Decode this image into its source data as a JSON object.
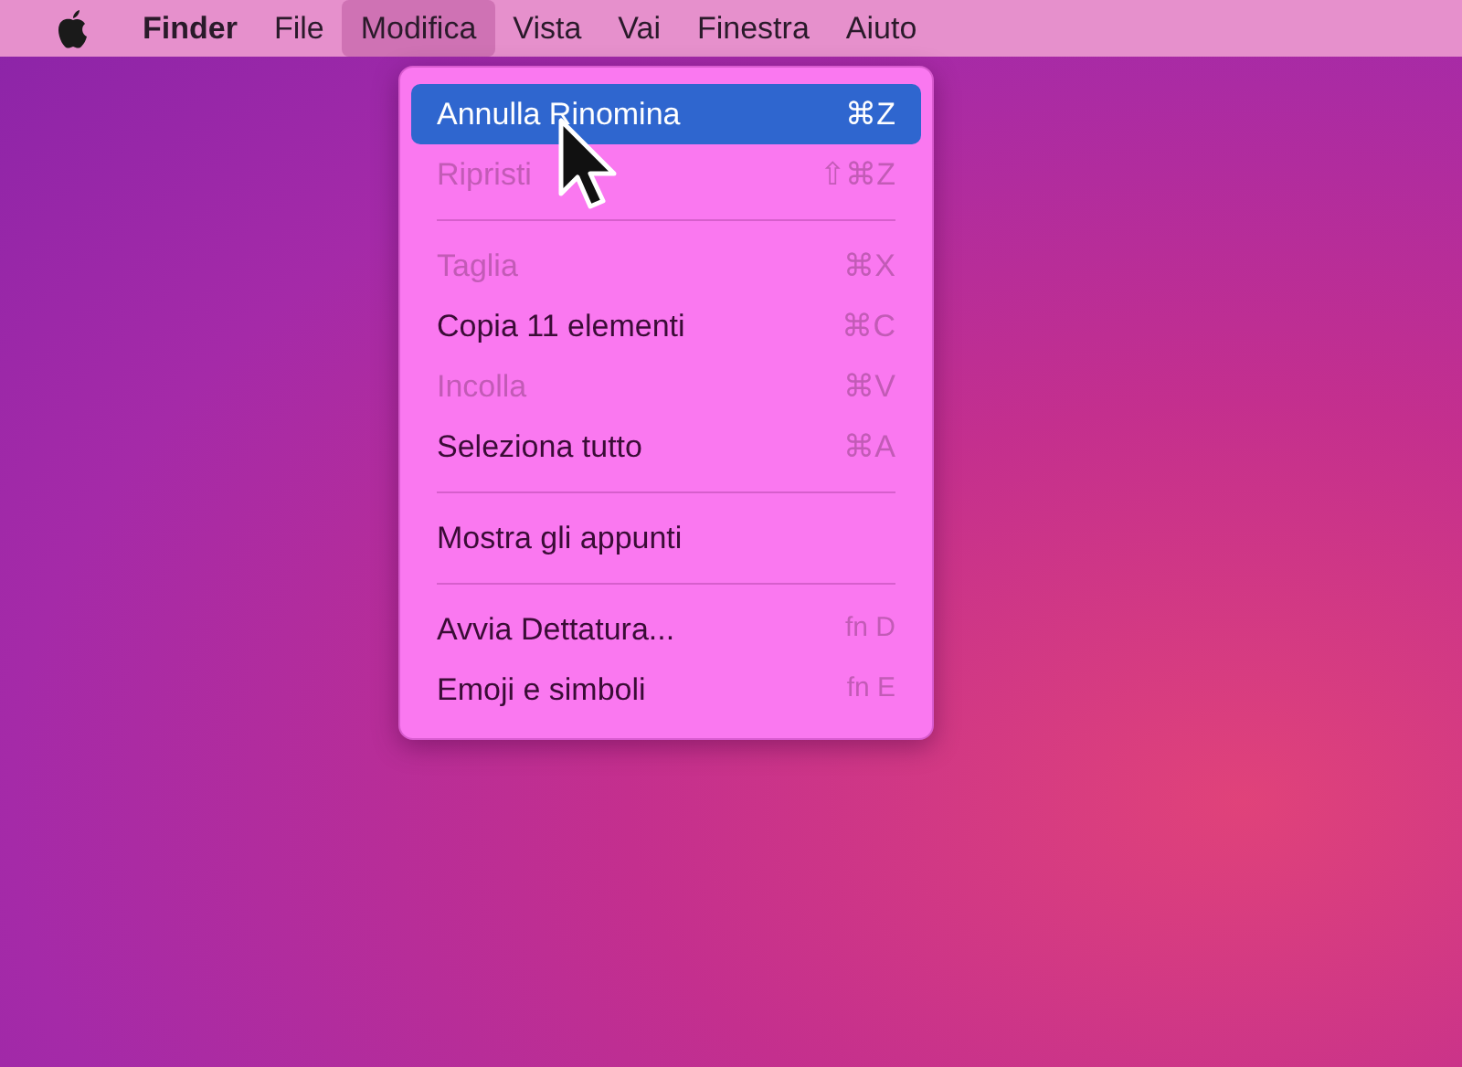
{
  "menu_bar": {
    "app": "Finder",
    "items": [
      {
        "label": "File",
        "selected": false
      },
      {
        "label": "Modifica",
        "selected": true
      },
      {
        "label": "Vista",
        "selected": false
      },
      {
        "label": "Vai",
        "selected": false
      },
      {
        "label": "Finestra",
        "selected": false
      },
      {
        "label": "Aiuto",
        "selected": false
      }
    ]
  },
  "dropdown": {
    "items": [
      {
        "kind": "item",
        "label": "Annulla Rinomina",
        "shortcut": "⌘Z",
        "selected": true,
        "disabled": false
      },
      {
        "kind": "item",
        "label": "Ripristi",
        "shortcut": "⇧⌘Z",
        "selected": false,
        "disabled": true
      },
      {
        "kind": "separator"
      },
      {
        "kind": "item",
        "label": "Taglia",
        "shortcut": "⌘X",
        "selected": false,
        "disabled": true
      },
      {
        "kind": "item",
        "label": "Copia 11 elementi",
        "shortcut": "⌘C",
        "selected": false,
        "disabled": false
      },
      {
        "kind": "item",
        "label": "Incolla",
        "shortcut": "⌘V",
        "selected": false,
        "disabled": true
      },
      {
        "kind": "item",
        "label": "Seleziona tutto",
        "shortcut": "⌘A",
        "selected": false,
        "disabled": false
      },
      {
        "kind": "separator"
      },
      {
        "kind": "item",
        "label": "Mostra gli appunti",
        "selected": false,
        "disabled": false
      },
      {
        "kind": "separator"
      },
      {
        "kind": "item",
        "label": "Avvia Dettatura...",
        "shortcut": "fn D",
        "selected": false,
        "disabled": false
      },
      {
        "kind": "item",
        "label": "Emoji e simboli",
        "shortcut": "fn E",
        "selected": false,
        "disabled": false
      }
    ]
  }
}
